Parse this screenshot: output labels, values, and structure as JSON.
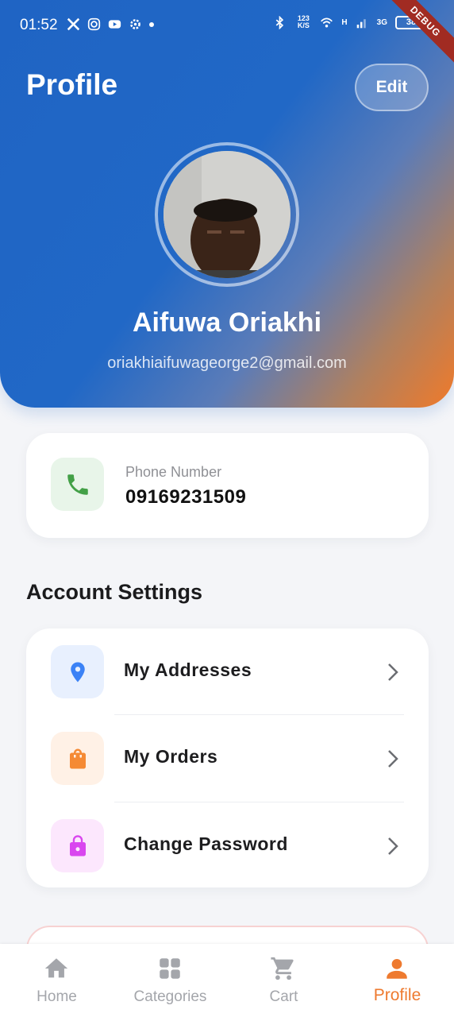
{
  "status_bar": {
    "time": "01:52",
    "net_speed": "123 K/S",
    "network_1": "H",
    "network_2": "3G",
    "battery": "38",
    "debug_banner": "DEBUG"
  },
  "header": {
    "title": "Profile",
    "edit_label": "Edit",
    "name": "Aifuwa Oriakhi",
    "email": "oriakhiaifuwageorge2@gmail.com"
  },
  "phone": {
    "label": "Phone Number",
    "value": "09169231509",
    "icon": "phone-icon"
  },
  "account_settings": {
    "title": "Account Settings",
    "items": [
      {
        "label": "My Addresses",
        "icon": "location-pin-icon",
        "icon_color": "#3b82f6",
        "icon_bg": "#e8f0fe"
      },
      {
        "label": "My Orders",
        "icon": "shopping-bag-icon",
        "icon_color": "#f58a34",
        "icon_bg": "#fff1e6"
      },
      {
        "label": "Change Password",
        "icon": "lock-icon",
        "icon_color": "#d946ef",
        "icon_bg": "#fce7fd"
      }
    ]
  },
  "nav": {
    "items": [
      {
        "label": "Home",
        "icon": "home-icon"
      },
      {
        "label": "Categories",
        "icon": "grid-icon"
      },
      {
        "label": "Cart",
        "icon": "cart-icon"
      },
      {
        "label": "Profile",
        "icon": "person-icon",
        "active": true
      }
    ],
    "active_color": "#ee7a2f",
    "inactive_color": "#a4a6ab"
  },
  "colors": {
    "header_blue": "#1f64c4",
    "header_orange": "#f07a2a",
    "background": "#f4f5f8"
  }
}
